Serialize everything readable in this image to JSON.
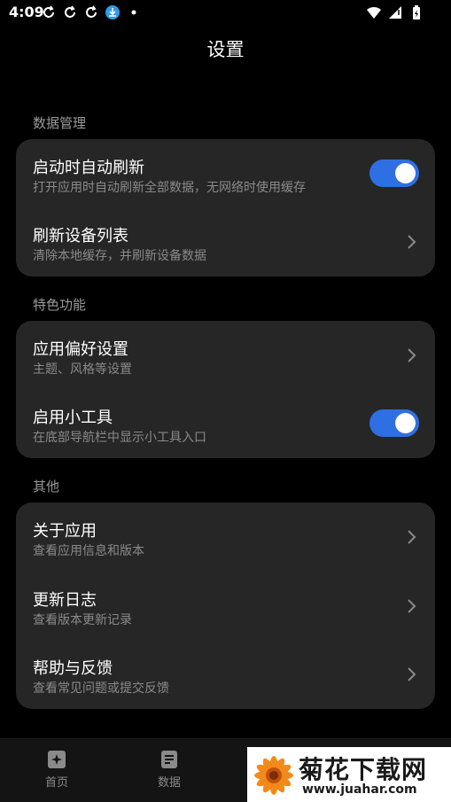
{
  "status_bar": {
    "time": "4:09",
    "left_icons": [
      "sync-icon",
      "sync-icon",
      "sync-icon",
      "download-icon",
      "dot-icon"
    ],
    "right_icons": [
      "wifi-icon",
      "signal-icon",
      "battery-charging-icon"
    ]
  },
  "page": {
    "title": "设置"
  },
  "sections": [
    {
      "title": "数据管理",
      "items": [
        {
          "title": "启动时自动刷新",
          "subtitle": "打开应用时自动刷新全部数据，无网络时使用缓存",
          "control": "toggle",
          "on": true
        },
        {
          "title": "刷新设备列表",
          "subtitle": "清除本地缓存，并刷新设备数据",
          "control": "chevron"
        }
      ]
    },
    {
      "title": "特色功能",
      "items": [
        {
          "title": "应用偏好设置",
          "subtitle": "主题、风格等设置",
          "control": "chevron"
        },
        {
          "title": "启用小工具",
          "subtitle": "在底部导航栏中显示小工具入口",
          "control": "toggle",
          "on": true
        }
      ]
    },
    {
      "title": "其他",
      "items": [
        {
          "title": "关于应用",
          "subtitle": "查看应用信息和版本",
          "control": "chevron"
        },
        {
          "title": "更新日志",
          "subtitle": "查看版本更新记录",
          "control": "chevron"
        },
        {
          "title": "帮助与反馈",
          "subtitle": "查看常见问题或提交反馈",
          "control": "chevron"
        }
      ]
    }
  ],
  "bottom_nav": [
    {
      "label": "首页",
      "icon": "home-sparkle-icon"
    },
    {
      "label": "数据",
      "icon": "document-icon"
    }
  ],
  "watermark": {
    "title": "菊花下载网",
    "url": "www.juahar.com"
  },
  "colors": {
    "background": "#000000",
    "card": "#262626",
    "accent": "#2f6fe4",
    "secondary_text": "#8a8a8a"
  }
}
